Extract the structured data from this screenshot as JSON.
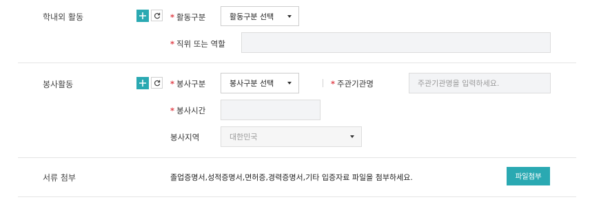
{
  "sections": {
    "campus": {
      "title": "학내외 활동",
      "activity_type_label": "활동구분",
      "activity_type_select": "활동구분 선택",
      "position_label": "직위 또는 역할",
      "position_value": ""
    },
    "volunteer": {
      "title": "봉사활동",
      "type_label": "봉사구분",
      "type_select": "봉사구분 선택",
      "org_label": "주관기관명",
      "org_placeholder": "주관기관명을 입력하세요.",
      "hours_label": "봉사시간",
      "hours_value": "",
      "region_label": "봉사지역",
      "region_select": "대한민국"
    },
    "attachment": {
      "title": "서류 첨부",
      "notice": "졸업증명서,성적증명서,면허증,경력증명서,기타 입증자료 파일을 첨부하세요.",
      "button": "파일첨부"
    }
  },
  "required_mark": "*",
  "colors": {
    "accent": "#2aa9b2",
    "required": "#e0424a"
  },
  "icons": {
    "add": "plus-icon",
    "reset": "refresh-icon",
    "dropdown": "caret-down-icon"
  }
}
